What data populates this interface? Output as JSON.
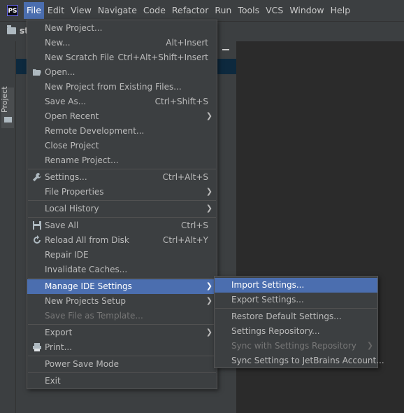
{
  "app": {
    "logo_text": "PS"
  },
  "menubar": {
    "items": [
      "File",
      "Edit",
      "View",
      "Navigate",
      "Code",
      "Refactor",
      "Run",
      "Tools",
      "VCS",
      "Window",
      "Help"
    ],
    "active": "File"
  },
  "navbar": {
    "project_name": "st"
  },
  "sidebar": {
    "project_tab_label": "Project"
  },
  "file_menu": {
    "items": [
      {
        "label": "New Project...",
        "shortcut": ""
      },
      {
        "label": "New...",
        "shortcut": "Alt+Insert"
      },
      {
        "label": "New Scratch File",
        "shortcut": "Ctrl+Alt+Shift+Insert"
      },
      {
        "label": "Open...",
        "shortcut": "",
        "icon": "folder-open-icon"
      },
      {
        "label": "New Project from Existing Files...",
        "shortcut": ""
      },
      {
        "label": "Save As...",
        "shortcut": "Ctrl+Shift+S"
      },
      {
        "label": "Open Recent",
        "submenu": true
      },
      {
        "label": "Remote Development...",
        "shortcut": ""
      },
      {
        "label": "Close Project",
        "shortcut": ""
      },
      {
        "label": "Rename Project...",
        "shortcut": ""
      },
      {
        "label": "Settings...",
        "shortcut": "Ctrl+Alt+S",
        "icon": "wrench-icon"
      },
      {
        "label": "File Properties",
        "submenu": true
      },
      {
        "label": "Local History",
        "submenu": true
      },
      {
        "label": "Save All",
        "shortcut": "Ctrl+S",
        "icon": "save-icon"
      },
      {
        "label": "Reload All from Disk",
        "shortcut": "Ctrl+Alt+Y",
        "icon": "reload-icon"
      },
      {
        "label": "Repair IDE",
        "shortcut": ""
      },
      {
        "label": "Invalidate Caches...",
        "shortcut": ""
      },
      {
        "label": "Manage IDE Settings",
        "submenu": true,
        "highlighted": true
      },
      {
        "label": "New Projects Setup",
        "submenu": true
      },
      {
        "label": "Save File as Template...",
        "disabled": true
      },
      {
        "label": "Export",
        "submenu": true
      },
      {
        "label": "Print...",
        "shortcut": "",
        "icon": "printer-icon"
      },
      {
        "label": "Power Save Mode",
        "shortcut": ""
      },
      {
        "label": "Exit",
        "shortcut": ""
      }
    ]
  },
  "manage_settings_submenu": {
    "items": [
      {
        "label": "Import Settings...",
        "highlighted": true
      },
      {
        "label": "Export Settings..."
      },
      {
        "label": "Restore Default Settings..."
      },
      {
        "label": "Settings Repository..."
      },
      {
        "label": "Sync with Settings Repository",
        "disabled": true,
        "submenu": true
      },
      {
        "label": "Sync Settings to JetBrains Account..."
      }
    ]
  },
  "colors": {
    "highlight": "#4b6eaf",
    "menu_bg": "#3c3f41",
    "editor_bg": "#2b2b2b",
    "text": "#bbbbbb",
    "disabled_text": "#777777"
  }
}
